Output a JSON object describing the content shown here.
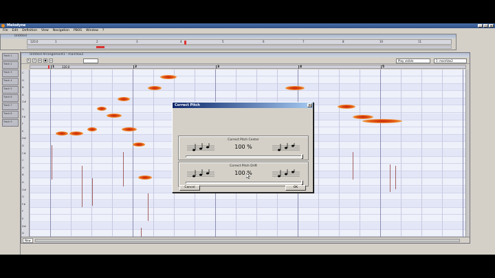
{
  "app": {
    "title": "Melodyne"
  },
  "menu": [
    "File",
    "Edit",
    "Definition",
    "View",
    "Navigation",
    "PBOS",
    "Window",
    "?"
  ],
  "top_window": {
    "title": "Untitled",
    "tempo": "120.0",
    "ticks": [
      "1",
      "2",
      "3",
      "4",
      "5",
      "6",
      "7",
      "8",
      "9",
      "10",
      "11"
    ]
  },
  "editor": {
    "title": "Untitled Arrangement1 - mainVox2",
    "tempo": "120.0",
    "play_mode": "Play visible",
    "track_select": "1: mainVox2",
    "ruler": [
      "1",
      "2",
      "3",
      "4",
      "5"
    ],
    "zoom": "Now",
    "note_labels": [
      "C",
      "H",
      "B",
      "A",
      "G#",
      "G",
      "F#",
      "F",
      "E",
      "D#",
      "D",
      "C#",
      "C",
      "H",
      "B",
      "A",
      "G#",
      "G",
      "F#",
      "F",
      "E",
      "D#",
      "D"
    ]
  },
  "tracks": [
    "Track 1",
    "Track 2",
    "Track 3",
    "Track 4",
    "Track 5",
    "Track 6",
    "Track 7",
    "Track 8",
    "Track 9"
  ],
  "dialog": {
    "title": "Correct Pitch",
    "center_label": "Correct Pitch Center",
    "center_value": "100 %",
    "center_percent": 100,
    "drift_label": "Correct Pitch Drift",
    "drift_value": "100 %",
    "drift_percent": 100,
    "cancel": "Cancel",
    "ok": "OK"
  }
}
